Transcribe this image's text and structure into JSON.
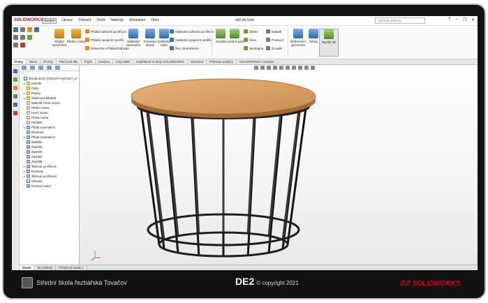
{
  "titlebar": {
    "logo": "SOLIDWORKS",
    "menus": [
      "Soubor",
      "Úpravy",
      "Zobrazit",
      "Vložit",
      "Nástroje",
      "Simulation",
      "Okno"
    ],
    "document_title": "stůl ala kruh",
    "search_placeholder": "Vyhledat příkazy"
  },
  "ribbon": {
    "big_buttons": [
      {
        "label": "Přidání vysunutím"
      },
      {
        "label": "Přidání rotací"
      },
      {
        "label": "Odebrání vysunutím"
      },
      {
        "label": "Průvodce dírami"
      },
      {
        "label": "Odebrání rotací"
      },
      {
        "label": "Zaoblit"
      },
      {
        "label": "Lineární pole"
      },
      {
        "label": "Referenční geometrie"
      },
      {
        "label": "Křivky"
      },
      {
        "label": "Rychlý 3D"
      }
    ],
    "small_buttons": [
      "Přidání tažením po křivce",
      "Přidání spojením profilů",
      "Ohraničení Přidání/Základu",
      "Odebrání tažením po křivce",
      "Odebrání spojením profilů",
      "Řez ohraničením",
      "Žebro",
      "Úkos",
      "Skořepina",
      "Nabalit",
      "Protnout",
      "Zrcadlit"
    ]
  },
  "command_tabs": [
    "Prvky",
    "Skica",
    "Plochy",
    "Plechové díly",
    "Popis",
    "Analýza",
    "Kóty MBD",
    "Doplňkové moduly SOLIDWORKS",
    "Simulace",
    "Příprava analýzy",
    "SOLIDWORKS Visualize"
  ],
  "tree": {
    "filter_icon": "funnel-icon",
    "nodes": [
      {
        "label": "stůl ala kruh  (Výchozí<<Výchozí>_Z",
        "icon": "part-icon",
        "expand": ""
      },
      {
        "label": "Historie",
        "icon": "folder-icon",
        "expand": "▸"
      },
      {
        "label": "Čidla",
        "icon": "folder-icon",
        "expand": ""
      },
      {
        "label": "Popisy",
        "icon": "folder-icon",
        "expand": "▸"
      },
      {
        "label": "Objemová těla(28)",
        "icon": "folder-icon",
        "expand": "▸"
      },
      {
        "label": "Materiál <není určen>",
        "icon": "material-icon",
        "expand": ""
      },
      {
        "label": "Přední rovina",
        "icon": "plane-icon",
        "expand": ""
      },
      {
        "label": "Horní rovina",
        "icon": "plane-icon",
        "expand": ""
      },
      {
        "label": "Pravá rovina",
        "icon": "plane-icon",
        "expand": ""
      },
      {
        "label": "Počátek",
        "icon": "origin-icon",
        "expand": ""
      },
      {
        "label": "Přidat vysunutím1",
        "icon": "feature-icon",
        "expand": "▸"
      },
      {
        "label": "Zkosení1",
        "icon": "feature-icon",
        "expand": ""
      },
      {
        "label": "Přidat vysunutím2",
        "icon": "feature-icon",
        "expand": "▸"
      },
      {
        "label": "Zaoblit1",
        "icon": "feature-icon",
        "expand": ""
      },
      {
        "label": "Zaoblit2",
        "icon": "feature-icon",
        "expand": ""
      },
      {
        "label": "Zaoblit3",
        "icon": "feature-icon",
        "expand": ""
      },
      {
        "label": "Zaoblit4",
        "icon": "feature-icon",
        "expand": ""
      },
      {
        "label": "Zaoblit5",
        "icon": "feature-icon",
        "expand": ""
      },
      {
        "label": "Tahnout po křivce1",
        "icon": "feature-icon",
        "expand": "▸"
      },
      {
        "label": "Rotovat1",
        "icon": "feature-icon",
        "expand": "▸"
      },
      {
        "label": "Tahnout po křivce2",
        "icon": "feature-icon",
        "expand": "▸"
      },
      {
        "label": "Skica16",
        "icon": "sketch-icon",
        "expand": ""
      },
      {
        "label": "Kruhové pole3",
        "icon": "feature-icon",
        "expand": ""
      }
    ]
  },
  "bottom_tabs": [
    "Model",
    "3D pohledy",
    "Pohybová studie 1"
  ],
  "footer": {
    "school": "Střední škola řezbářská Tovačov",
    "code": "DE2",
    "copyright": "© copyright 2021",
    "brand": "SOLIDWORKS"
  },
  "colors": {
    "accent": "#d0021b",
    "tabletop": "#d9a46a",
    "legs": "#1e1e1e"
  }
}
